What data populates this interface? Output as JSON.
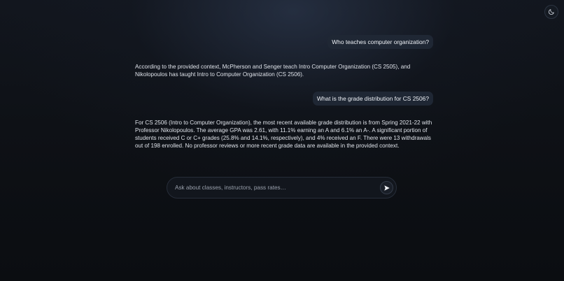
{
  "header": {
    "theme_toggle_icon": "moon-icon"
  },
  "conversation": [
    {
      "role": "user",
      "text": "Who teaches computer organization?"
    },
    {
      "role": "assistant",
      "text": "According to the provided context, McPherson and Senger teach Intro Computer Organization (CS 2505), and Nikolopoulos has taught Intro to Computer Organization (CS 2506)."
    },
    {
      "role": "user",
      "text": "What is the grade distribution for CS 2506?"
    },
    {
      "role": "assistant",
      "text": "For CS 2506 (Intro to Computer Organization), the most recent available grade distribution is from Spring 2021-22 with Professor Nikolopoulos. The average GPA was 2.61, with 11.1% earning an A and 6.1% an A-. A significant portion of students received C or C+ grades (25.8% and 14.1%, respectively), and 4% received an F. There were 13 withdrawals out of 198 enrolled. No professor reviews or more recent grade data are available in the provided context."
    }
  ],
  "composer": {
    "placeholder": "Ask about classes, instructors, pass rates…",
    "value": "",
    "send_icon": "send-icon"
  },
  "colors": {
    "background": "#0e1116",
    "user_bubble": "#1f2734",
    "text": "#dfe3ea"
  }
}
